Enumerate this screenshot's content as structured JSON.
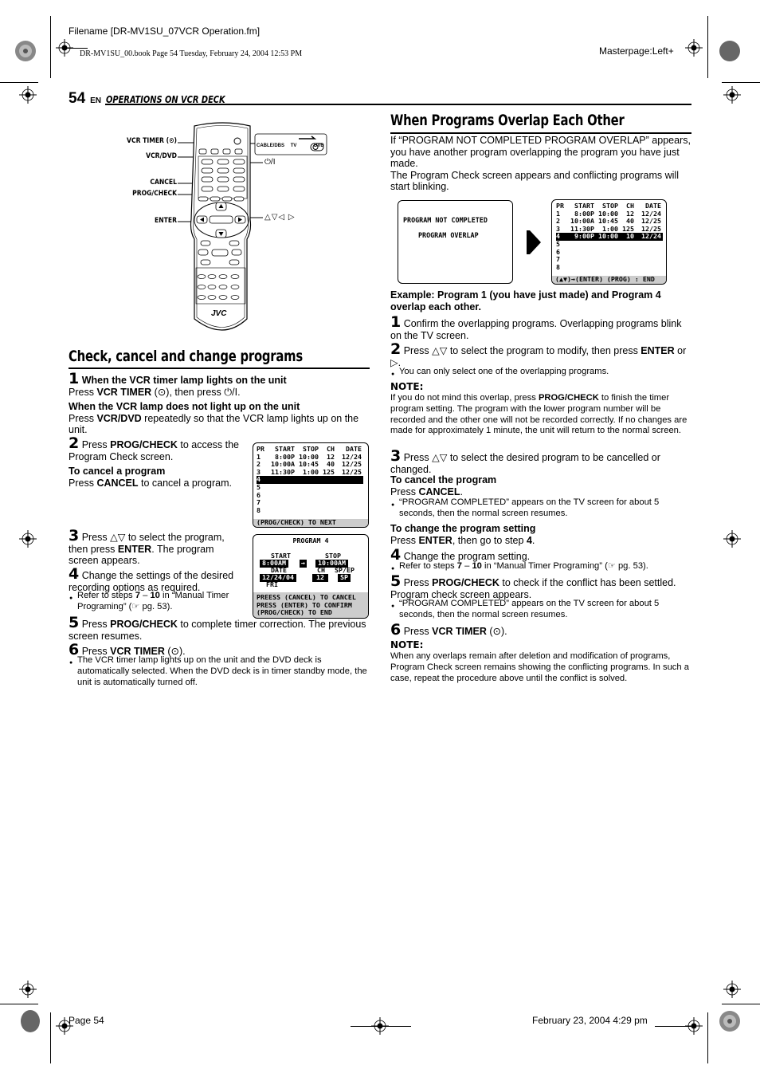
{
  "print_header": {
    "filename": "Filename [DR-MV1SU_07VCR Operation.fm]",
    "book_line": "DR-MV1SU_00.book  Page 54  Tuesday, February 24, 2004  12:53 PM",
    "masterpage": "Masterpage:Left+"
  },
  "page_header": {
    "page_number": "54",
    "lang": "EN",
    "section": "OPERATIONS ON VCR DECK"
  },
  "remote_figure": {
    "callouts_left": [
      "VCR TIMER (⊙)",
      "VCR/DVD",
      "CANCEL",
      "PROG/CHECK",
      "ENTER"
    ],
    "callouts_right": [
      "⏻/I",
      "△▽◁ ▷"
    ],
    "switch_labels": [
      "CABLE/DBS",
      "TV",
      "DVD"
    ],
    "brand": "JVC",
    "icons": [
      "remote-control-icon",
      "power-icon",
      "timer-clock-icon"
    ]
  },
  "left": {
    "title": "Check, cancel and change programs",
    "step1": {
      "num": "1",
      "heading": "When the VCR timer lamp lights on the unit",
      "text_a": "Press ",
      "btn_a": "VCR TIMER",
      "text_b": " (⊙), then press ⏻/I.",
      "heading2": "When the VCR lamp does not light up on the unit",
      "text2_a": "Press ",
      "btn2": "VCR/DVD",
      "text2_b": " repeatedly so that the VCR lamp lights up on the unit."
    },
    "step2": {
      "num": "2",
      "text_a": " Press ",
      "btn": "PROG/CHECK",
      "text_b": " to access the Program Check screen.",
      "cancel_heading": "To cancel a program",
      "cancel_a": "Press ",
      "cancel_btn": "CANCEL",
      "cancel_b": " to cancel a program."
    },
    "step3": {
      "num": "3",
      "text_a": " Press △▽ to select the program, then press ",
      "btn": "ENTER",
      "text_b": ". The program screen appears."
    },
    "step4": {
      "num": "4",
      "text": " Change the settings of the desired recording options as required.",
      "bullet_a": "Refer to steps ",
      "bullet_b1": "7",
      "bullet_mid": " – ",
      "bullet_b2": "10",
      "bullet_c": " in “Manual Timer Programing” (☞ pg. 53)."
    },
    "step5": {
      "num": "5",
      "text_a": " Press ",
      "btn": "PROG/CHECK",
      "text_b": " to complete timer correction. The previous screen resumes."
    },
    "step6": {
      "num": "6",
      "text_a": " Press ",
      "btn": "VCR TIMER",
      "text_b": " (⊙).",
      "bullet": "The VCR timer lamp lights up on the unit and the DVD deck is automatically selected. When the DVD deck is in timer standby mode, the unit is automatically turned off."
    }
  },
  "program_check_screen": {
    "headers": [
      "PR",
      "START",
      "STOP",
      "CH",
      "DATE"
    ],
    "rows": [
      [
        "1",
        "8:00P",
        "10:00",
        "12",
        "12/24"
      ],
      [
        "2",
        "10:00A",
        "10:45",
        "40",
        "12/25"
      ],
      [
        "3",
        "11:30P",
        "1:00",
        "125",
        "12/25"
      ],
      [
        "4",
        "",
        "",
        "",
        ""
      ],
      [
        "5",
        "",
        "",
        "",
        ""
      ],
      [
        "6",
        "",
        "",
        "",
        ""
      ],
      [
        "7",
        "",
        "",
        "",
        ""
      ],
      [
        "8",
        "",
        "",
        "",
        ""
      ]
    ],
    "selected_row": 4,
    "footer": "(PROG/CHECK) TO NEXT"
  },
  "program4_screen": {
    "title": "PROGRAM 4",
    "start_label": "START",
    "start_value": "8:00AM",
    "arrow": "→",
    "stop_label": "STOP",
    "stop_value": "10:00AM",
    "date_label": "DATE",
    "date_value": "12/24/04",
    "day": "FRI",
    "ch_label": "CH",
    "ch_value": "12",
    "speed_label": "SP/EP",
    "speed_value": "SP",
    "footer": [
      "PREESS (CANCEL) TO CANCEL",
      "PRESS (ENTER) TO CONFIRM",
      "(PROG/CHECK) TO END"
    ]
  },
  "right": {
    "title": "When Programs Overlap Each Other",
    "intro1": "If “PROGRAM NOT COMPLETED PROGRAM OVERLAP” appears, you have another program overlapping the program you have just made.",
    "intro2": "The Program Check screen appears and conflicting programs will start blinking.",
    "overlap_screen": {
      "line1": "PROGRAM NOT COMPLETED",
      "line2": "PROGRAM OVERLAP"
    },
    "arrow_icon": "right-arrow-icon",
    "check_screen": {
      "headers": [
        "PR",
        "START",
        "STOP",
        "CH",
        "DATE"
      ],
      "rows": [
        [
          "1",
          "8:00P",
          "10:00",
          "12",
          "12/24"
        ],
        [
          "2",
          "10:00A",
          "10:45",
          "40",
          "12/25"
        ],
        [
          "3",
          "11:30P",
          "1:00",
          "125",
          "12/25"
        ],
        [
          "4",
          "9:00P",
          "10:00",
          "10",
          "12/24"
        ],
        [
          "5",
          "",
          "",
          "",
          ""
        ],
        [
          "6",
          "",
          "",
          "",
          ""
        ],
        [
          "7",
          "",
          "",
          "",
          ""
        ],
        [
          "8",
          "",
          "",
          "",
          ""
        ]
      ],
      "selected_row": 4,
      "footer": "(▲▼)→(ENTER) (PROG) : END"
    },
    "example": "Example: Program 1 (you have just made) and Program 4 overlap each other.",
    "step1": {
      "num": "1",
      "text": " Confirm the overlapping programs. Overlapping programs blink on the TV screen."
    },
    "step2": {
      "num": "2",
      "text_a": " Press △▽ to select the program to modify, then press ",
      "btn": "ENTER",
      "text_b": " or ▷.",
      "bullet": "You can only select one of the overlapping programs."
    },
    "note1_label": "NOTE:",
    "note1_a": "If you do not mind this overlap, press ",
    "note1_btn": "PROG/CHECK",
    "note1_b": " to finish the timer program setting. The program with the lower program number will be recorded and the other one will not be recorded correctly. If no changes are made for approximately 1 minute, the unit will return to the normal screen.",
    "step3": {
      "num": "3",
      "text": " Press △▽ to select the desired program to be cancelled or changed."
    },
    "cancel_heading": "To cancel the program",
    "cancel_a": "Press ",
    "cancel_btn": "CANCEL",
    "cancel_b": ".",
    "cancel_bullet": "“PROGRAM COMPLETED” appears on the TV screen for about 5 seconds, then the normal screen resumes.",
    "change_heading": "To change the program setting",
    "change_a": "Press ",
    "change_btn": "ENTER",
    "change_b": ", then go to step ",
    "change_step": "4",
    "change_c": ".",
    "step4": {
      "num": "4",
      "text": " Change the program setting.",
      "bullet_a": "Refer to steps ",
      "bullet_b1": "7",
      "bullet_mid": " – ",
      "bullet_b2": "10",
      "bullet_c": " in “Manual Timer Programing” (☞ pg. 53)."
    },
    "step5": {
      "num": "5",
      "text_a": " Press ",
      "btn": "PROG/CHECK",
      "text_b": " to check if the conflict has been settled. Program check screen appears.",
      "bullet": "“PROGRAM COMPLETED” appears on the TV screen for about 5 seconds, then the normal screen resumes."
    },
    "step6": {
      "num": "6",
      "text_a": " Press ",
      "btn": "VCR TIMER",
      "text_b": " (⊙)."
    },
    "note2_label": "NOTE:",
    "note2": "When any overlaps remain after deletion and modification of programs, Program Check screen remains showing the conflicting programs. In such a case, repeat the procedure above until the conflict is solved."
  },
  "print_footer": {
    "page": "Page 54",
    "date": "February 23, 2004 4:29 pm"
  }
}
